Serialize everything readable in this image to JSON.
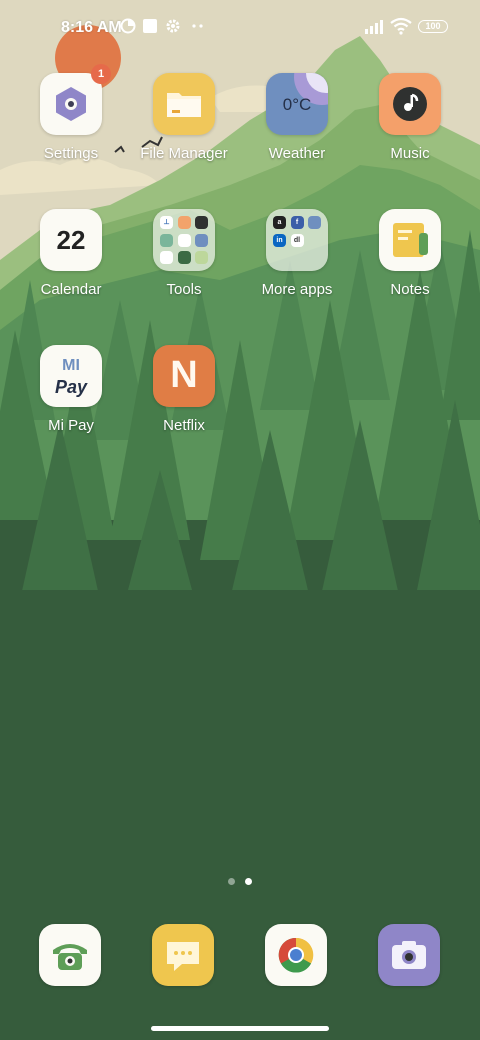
{
  "status": {
    "time": "8:16 AM",
    "battery": "100"
  },
  "apps": [
    {
      "label": "Settings",
      "badge": "1"
    },
    {
      "label": "File Manager"
    },
    {
      "label": "Weather",
      "temp": "0°C"
    },
    {
      "label": "Music"
    },
    {
      "label": "Calendar",
      "date": "22"
    },
    {
      "label": "Tools"
    },
    {
      "label": "More apps"
    },
    {
      "label": "Notes"
    },
    {
      "label": "Mi Pay",
      "line1": "MI",
      "line2": "Pay"
    },
    {
      "label": "Netflix",
      "letter": "N"
    }
  ],
  "folders": {
    "more_apps": {
      "a": "a",
      "f": "f",
      "in": "in",
      "dl": "dl"
    }
  },
  "pager": {
    "pages": 2,
    "current": 2
  },
  "colors": {
    "sky": "#ded8bf",
    "forest_dark": "#365c3c",
    "sun": "#e07a4a",
    "badge": "#e66a4a",
    "file_manager": "#f0c75a",
    "weather": "#6f8fbf",
    "music": "#f4a06a",
    "notes": "#efc64e",
    "netflix": "#e07d45",
    "phone": "#5e9e57",
    "messages": "#efc64e",
    "camera": "#8f86c8"
  }
}
